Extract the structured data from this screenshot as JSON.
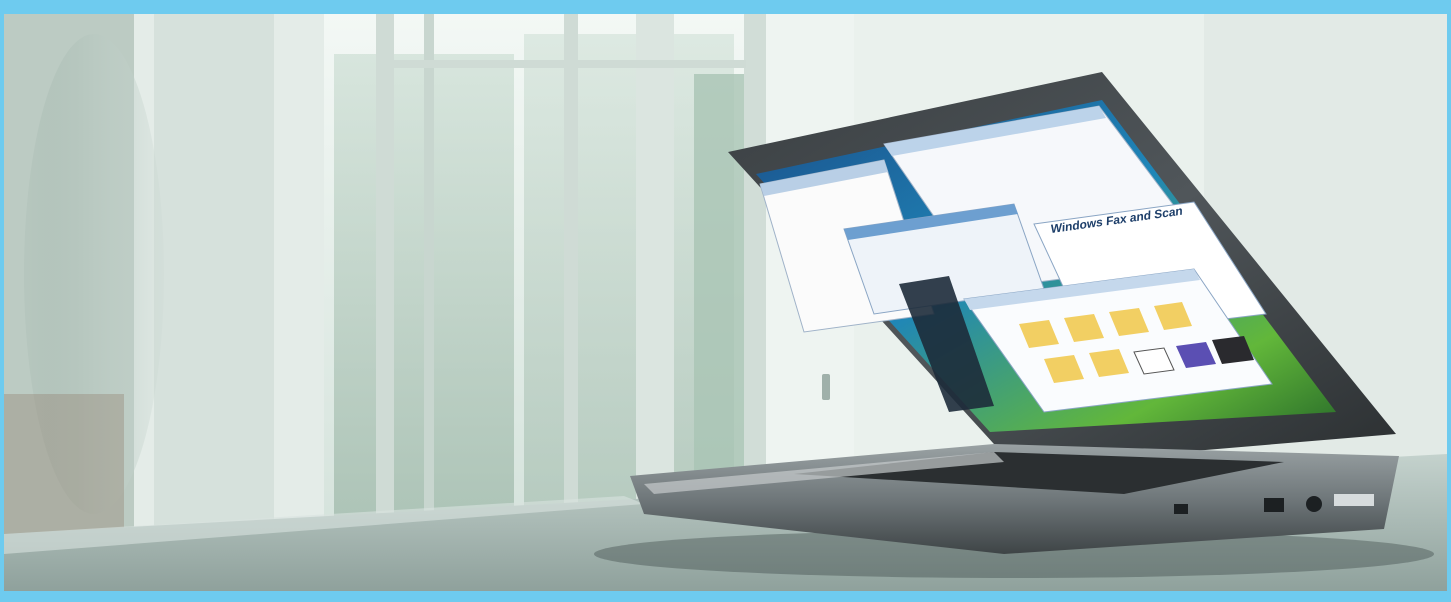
{
  "scene": {
    "subject": "laptop",
    "setting": "bright office with tall windows",
    "frame_color": "#6ecbef"
  },
  "screen": {
    "window_title": "Windows Fax and Scan"
  }
}
